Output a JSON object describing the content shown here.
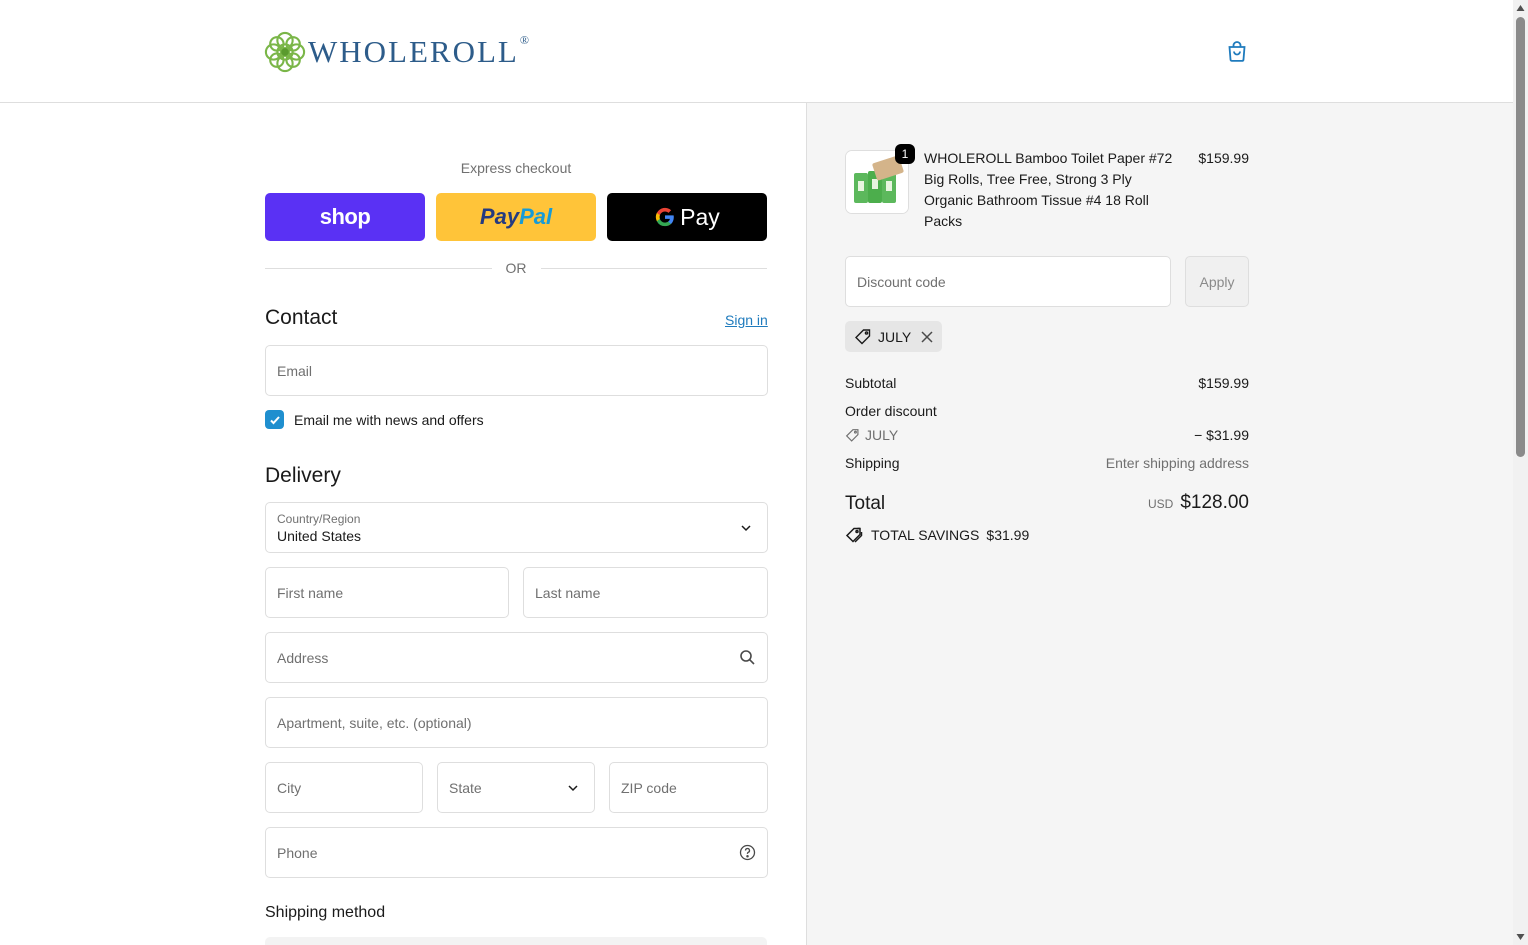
{
  "brand": {
    "name": "WHOLEROLL",
    "reg": "®",
    "accent": "#2d5c8a"
  },
  "header": {
    "cart_icon": "shopping-bag-icon"
  },
  "express": {
    "label": "Express checkout",
    "shop_label": "shop",
    "paypal_part1": "Pay",
    "paypal_part2": "Pal",
    "gpay_label": "Pay",
    "or_label": "OR"
  },
  "contact": {
    "title": "Contact",
    "sign_in": "Sign in",
    "email_placeholder": "Email",
    "newsletter_label": "Email me with news and offers",
    "newsletter_checked": true
  },
  "delivery": {
    "title": "Delivery",
    "country_label": "Country/Region",
    "country_value": "United States",
    "first_name": "First name",
    "last_name": "Last name",
    "address": "Address",
    "apartment": "Apartment, suite, etc. (optional)",
    "city": "City",
    "state": "State",
    "zip": "ZIP code",
    "phone": "Phone"
  },
  "shipping_method": {
    "title": "Shipping method"
  },
  "order": {
    "item": {
      "quantity": "1",
      "name": "WHOLEROLL Bamboo Toilet Paper #72 Big Rolls, Tree Free, Strong 3 Ply Organic Bathroom Tissue #4 18 Roll Packs",
      "price": "$159.99"
    },
    "discount_placeholder": "Discount code",
    "apply_label": "Apply",
    "applied_code": "JULY",
    "subtotal_label": "Subtotal",
    "subtotal_value": "$159.99",
    "order_discount_label": "Order discount",
    "discount_code": "JULY",
    "discount_value": "− $31.99",
    "shipping_label": "Shipping",
    "shipping_value": "Enter shipping address",
    "total_label": "Total",
    "total_currency": "USD",
    "total_value": "$128.00",
    "savings_label": "TOTAL SAVINGS",
    "savings_value": "$31.99"
  }
}
